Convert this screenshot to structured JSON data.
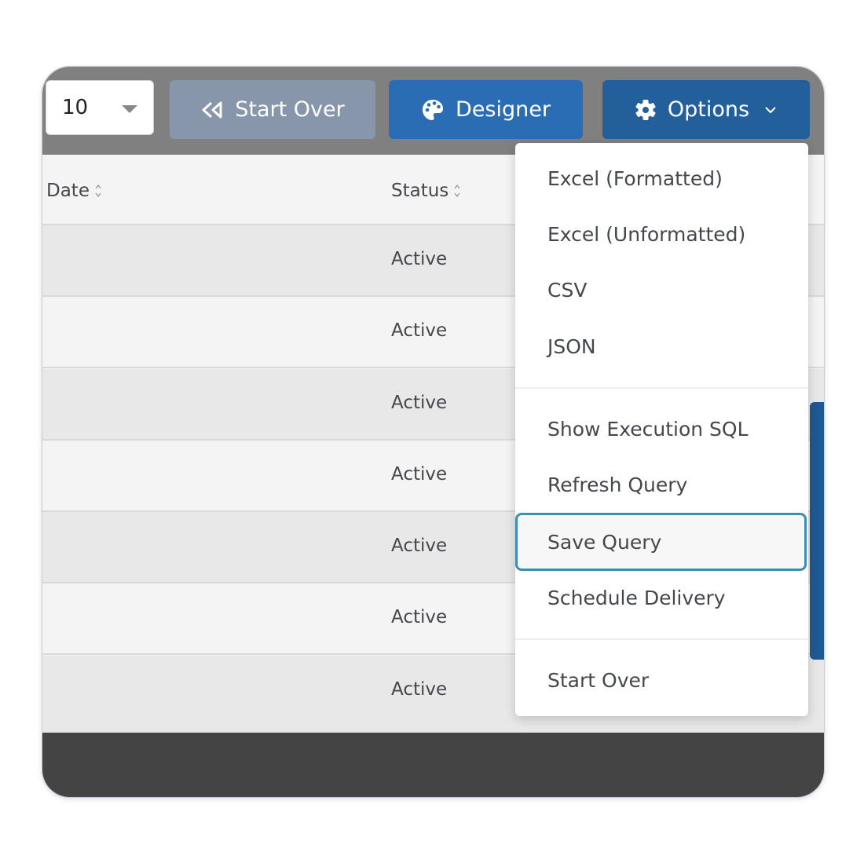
{
  "toolbar": {
    "page_size": {
      "value": "10",
      "icon": "caret-down-icon"
    },
    "start_over": {
      "label": "Start Over",
      "icon": "backward-icon"
    },
    "designer": {
      "label": "Designer",
      "icon": "palette-icon"
    },
    "options": {
      "label": "Options",
      "icon": "gear-icon",
      "caret": "chevron-down-icon"
    }
  },
  "table": {
    "columns": [
      {
        "label": "Date",
        "sortable": true
      },
      {
        "label": "Status",
        "sortable": true
      }
    ],
    "rows": [
      {
        "date": "",
        "status": "Active"
      },
      {
        "date": "",
        "status": "Active"
      },
      {
        "date": "",
        "status": "Active"
      },
      {
        "date": "",
        "status": "Active"
      },
      {
        "date": "",
        "status": "Active"
      },
      {
        "date": "",
        "status": "Active"
      },
      {
        "date": "",
        "status": "Active"
      }
    ]
  },
  "options_menu": {
    "groups": [
      [
        {
          "label": "Excel (Formatted)"
        },
        {
          "label": "Excel (Unformatted)"
        },
        {
          "label": "CSV"
        },
        {
          "label": "JSON"
        }
      ],
      [
        {
          "label": "Show Execution SQL"
        },
        {
          "label": "Refresh Query"
        },
        {
          "label": "Save Query",
          "focused": true
        },
        {
          "label": "Schedule Delivery"
        }
      ],
      [
        {
          "label": "Start Over"
        }
      ]
    ]
  },
  "colors": {
    "toolbar_bg": "#808080",
    "start_over_bg": "#8796aa",
    "designer_bg": "#2a6db5",
    "options_bg": "#235f9a",
    "focus_ring": "#3b8fb3",
    "footer_bg": "#444444",
    "row_odd": "#e8e8e8",
    "row_even": "#f4f4f4"
  }
}
